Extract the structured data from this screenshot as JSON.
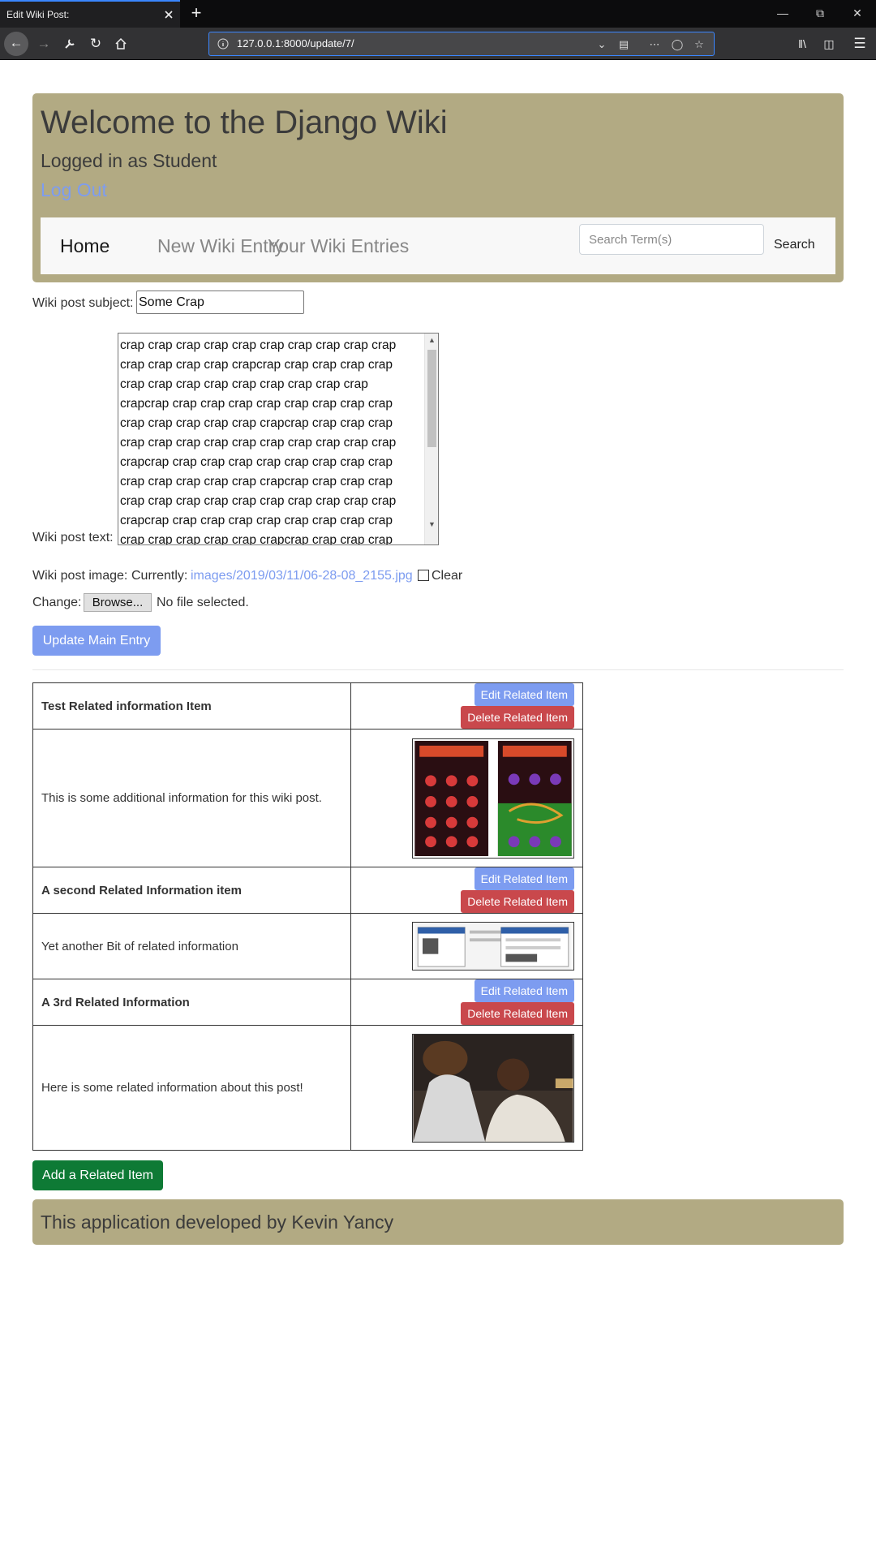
{
  "browser": {
    "tab_title": "Edit Wiki Post:",
    "url": "127.0.0.1:8000/update/7/"
  },
  "header": {
    "site_title": "Welcome to the Django Wiki",
    "login_status": "Logged in as Student",
    "logout_label": "Log Out"
  },
  "nav": {
    "home": "Home",
    "new_entry": "New Wiki Entry",
    "your_entries": "Your Wiki Entries",
    "search_placeholder": "Search Term(s)",
    "search_button": "Search"
  },
  "form": {
    "subject_label": "Wiki post subject:",
    "subject_value": "Some Crap",
    "text_label": "Wiki post text:",
    "text_value": "crap crap crap crap crap crap crap crap crap crap\ncrap crap crap crap crapcrap crap crap crap crap\ncrap crap crap crap crap crap crap crap crap\ncrapcrap crap crap crap crap crap crap crap crap\ncrap crap crap crap crap crapcrap crap crap crap\ncrap crap crap crap crap crap crap crap crap crap\ncrapcrap crap crap crap crap crap crap crap crap\ncrap crap crap crap crap crapcrap crap crap crap\ncrap crap crap crap crap crap crap crap crap crap\ncrapcrap crap crap crap crap crap crap crap crap\ncrap crap crap crap crap crapcrap crap crap crap",
    "image_label": "Wiki post image:",
    "currently_label": "Currently:",
    "current_file": "images/2019/03/11/06-28-08_2155.jpg",
    "clear_label": "Clear",
    "change_label": "Change:",
    "browse_button": "Browse...",
    "no_file": "No file selected.",
    "update_button": "Update Main Entry"
  },
  "related": {
    "edit_label": "Edit Related Item",
    "delete_label": "Delete Related Item",
    "items": [
      {
        "title": "Test Related information Item",
        "text": "This is some additional information for this wiki post."
      },
      {
        "title": "A second Related Information item",
        "text": "Yet another Bit of related information"
      },
      {
        "title": "A 3rd Related Information",
        "text": "Here is some related information about this post!"
      }
    ],
    "add_button": "Add a Related Item"
  },
  "footer": {
    "text": "This application developed by Kevin Yancy"
  },
  "colors": {
    "banner": "#b2aa83",
    "primary": "#7d9cf0",
    "danger": "#c9484c",
    "success": "#0e7a35"
  }
}
